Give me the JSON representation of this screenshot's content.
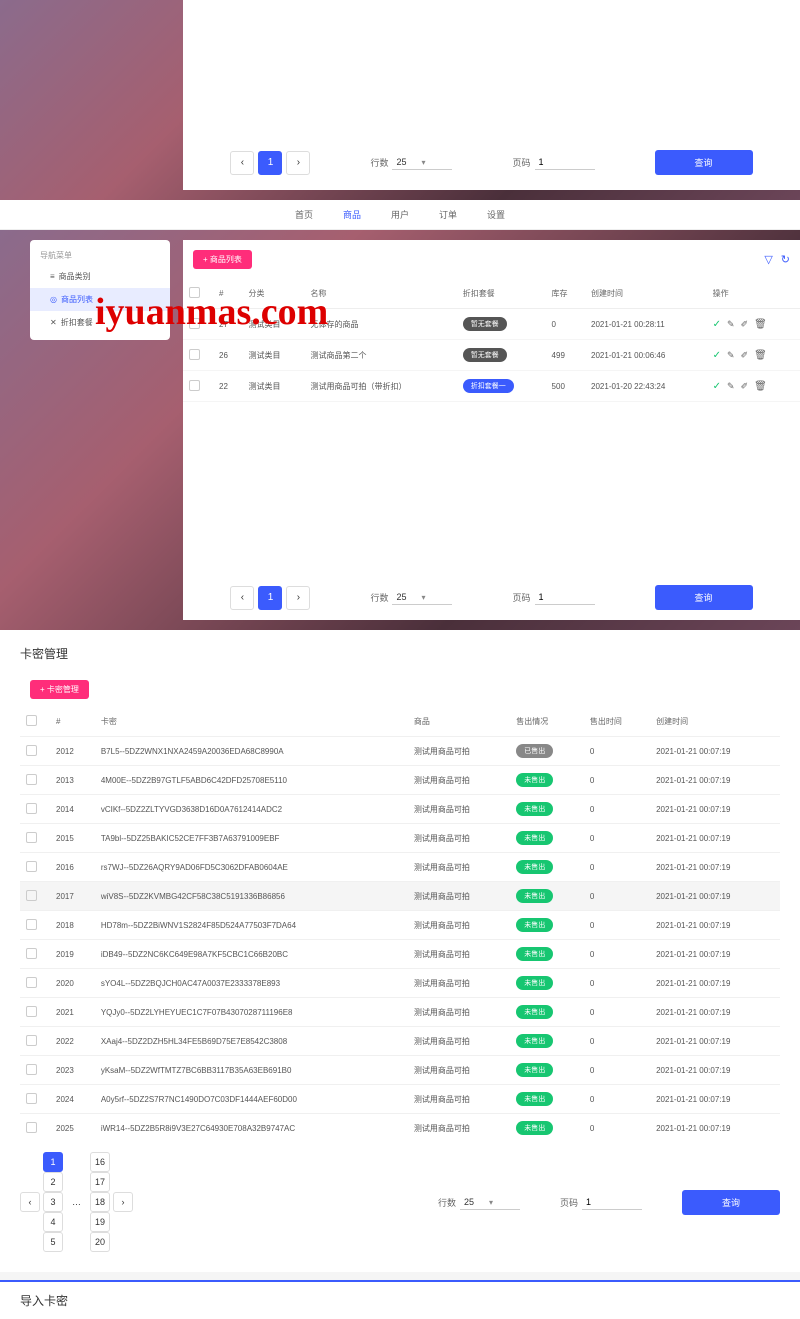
{
  "watermark": "iyuanmas.com",
  "pagination": {
    "rows_label": "行数",
    "rows_value": "25",
    "page_label": "页码",
    "page_value": "1",
    "query_btn": "查询"
  },
  "nav": {
    "home": "首页",
    "product": "商品",
    "user": "用户",
    "order": "订单",
    "settings": "设置"
  },
  "sidebar": {
    "title": "导航菜单",
    "items": [
      {
        "icon": "≡",
        "label": "商品类别"
      },
      {
        "icon": "◎",
        "label": "商品列表"
      },
      {
        "icon": "✕",
        "label": "折扣套餐"
      }
    ]
  },
  "products": {
    "add_btn": "+ 商品列表",
    "headers": {
      "id": "#",
      "cat": "分类",
      "name": "名称",
      "discount": "折扣套餐",
      "stock": "库存",
      "created": "创建时间",
      "ops": "操作"
    },
    "rows": [
      {
        "id": "27",
        "cat": "测试类目",
        "name": "无体存的商品",
        "badge": "暂无套餐",
        "badge_cls": "badge-dark",
        "stock": "0",
        "time": "2021-01-21 00:28:11"
      },
      {
        "id": "26",
        "cat": "测试类目",
        "name": "测试商品第二个",
        "badge": "暂无套餐",
        "badge_cls": "badge-dark",
        "stock": "499",
        "time": "2021-01-21 00:06:46"
      },
      {
        "id": "22",
        "cat": "测试类目",
        "name": "测试用商品可拍（带折扣）",
        "badge": "折扣套餐一",
        "badge_cls": "badge-blue",
        "stock": "500",
        "time": "2021-01-20 22:43:24"
      }
    ]
  },
  "cards": {
    "title": "卡密管理",
    "add_btn": "+ 卡密管理",
    "headers": {
      "id": "#",
      "key": "卡密",
      "product": "商品",
      "status": "售出情况",
      "sold_time": "售出时间",
      "created": "创建时间"
    },
    "rows": [
      {
        "id": "2012",
        "key": "B7L5--5DZ2WNX1NXA2459A20036EDA68C8990A",
        "product": "测试用商品可拍",
        "badge": "已售出",
        "badge_cls": "badge-gray",
        "sold": "0",
        "time": "2021-01-21 00:07:19"
      },
      {
        "id": "2013",
        "key": "4M00E--5DZ2B97GTLF5ABD6C42DFD25708E5110",
        "product": "测试用商品可拍",
        "badge": "未售出",
        "badge_cls": "badge-green",
        "sold": "0",
        "time": "2021-01-21 00:07:19"
      },
      {
        "id": "2014",
        "key": "vCIKf--5DZ2ZLTYVGD3638D16D0A7612414ADC2",
        "product": "测试用商品可拍",
        "badge": "未售出",
        "badge_cls": "badge-green",
        "sold": "0",
        "time": "2021-01-21 00:07:19"
      },
      {
        "id": "2015",
        "key": "TA9bl--5DZ25BAKIC52CE7FF3B7A63791009EBF",
        "product": "测试用商品可拍",
        "badge": "未售出",
        "badge_cls": "badge-green",
        "sold": "0",
        "time": "2021-01-21 00:07:19"
      },
      {
        "id": "2016",
        "key": "rs7WJ--5DZ26AQRY9AD06FD5C3062DFAB0604AE",
        "product": "测试用商品可拍",
        "badge": "未售出",
        "badge_cls": "badge-green",
        "sold": "0",
        "time": "2021-01-21 00:07:19"
      },
      {
        "id": "2017",
        "key": "wiV8S--5DZ2KVMBG42CF58C38C5191336B86856",
        "product": "测试用商品可拍",
        "badge": "未售出",
        "badge_cls": "badge-green",
        "sold": "0",
        "time": "2021-01-21 00:07:19",
        "highlight": true
      },
      {
        "id": "2018",
        "key": "HD78m--5DZ2BiWNV1S2824F85D524A77503F7DA64",
        "product": "测试用商品可拍",
        "badge": "未售出",
        "badge_cls": "badge-green",
        "sold": "0",
        "time": "2021-01-21 00:07:19"
      },
      {
        "id": "2019",
        "key": "iDB49--5DZ2NC6KC649E98A7KF5CBC1C66B20BC",
        "product": "测试用商品可拍",
        "badge": "未售出",
        "badge_cls": "badge-green",
        "sold": "0",
        "time": "2021-01-21 00:07:19"
      },
      {
        "id": "2020",
        "key": "sYO4L--5DZ2BQJCH0AC47A0037E2333378E893",
        "product": "测试用商品可拍",
        "badge": "未售出",
        "badge_cls": "badge-green",
        "sold": "0",
        "time": "2021-01-21 00:07:19"
      },
      {
        "id": "2021",
        "key": "YQJy0--5DZ2LYHEYUEC1C7F07B4307028711196E8",
        "product": "测试用商品可拍",
        "badge": "未售出",
        "badge_cls": "badge-green",
        "sold": "0",
        "time": "2021-01-21 00:07:19"
      },
      {
        "id": "2022",
        "key": "XAaj4--5DZ2DZH5HL34FE5B69D75E7E8542C3808",
        "product": "测试用商品可拍",
        "badge": "未售出",
        "badge_cls": "badge-green",
        "sold": "0",
        "time": "2021-01-21 00:07:19"
      },
      {
        "id": "2023",
        "key": "yKsaM--5DZ2WfTMTZ7BC6BB3117B35A63EB691B0",
        "product": "测试用商品可拍",
        "badge": "未售出",
        "badge_cls": "badge-green",
        "sold": "0",
        "time": "2021-01-21 00:07:19"
      },
      {
        "id": "2024",
        "key": "A0y5rf--5DZ2S7R7NC1490DO7C03DF1444AEF60D00",
        "product": "测试用商品可拍",
        "badge": "未售出",
        "badge_cls": "badge-green",
        "sold": "0",
        "time": "2021-01-21 00:07:19"
      },
      {
        "id": "2025",
        "key": "iWR14--5DZ2B5R8i9V3E27C64930E708A32B9747AC",
        "product": "测试用商品可拍",
        "badge": "未售出",
        "badge_cls": "badge-green",
        "sold": "0",
        "time": "2021-01-21 00:07:19"
      }
    ],
    "pages": [
      "1",
      "2",
      "3",
      "4",
      "5"
    ],
    "pages_end": [
      "16",
      "17",
      "18",
      "19",
      "20"
    ]
  },
  "import_title": "导入卡密"
}
